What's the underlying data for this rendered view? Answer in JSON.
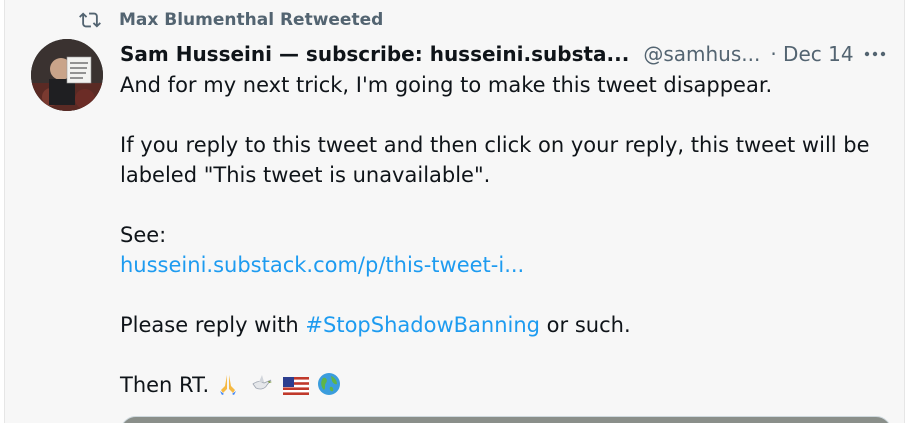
{
  "retweet": {
    "icon": "retweet-icon",
    "label": "Max Blumenthal Retweeted"
  },
  "author": {
    "name": "Sam Husseini — subscribe: husseini.substa...",
    "handle": "@samhus...",
    "date": "· Dec 14",
    "avatar_icon": "avatar"
  },
  "more_icon": "more-icon",
  "body": {
    "line1": "And for my next trick, I'm going to make this tweet disappear.",
    "para2": "If you reply to this tweet and then click on your reply, this tweet will be labeled \"This tweet is unavailable\".",
    "see_label": "See:",
    "link": "husseini.substack.com/p/this-tweet-i...",
    "reply_prefix": "Please reply with ",
    "hashtag": "#StopShadowBanning",
    "reply_suffix": " or such.",
    "final": "Then RT.",
    "emojis": [
      "folded-hands-emoji",
      "dove-emoji",
      "us-flag-emoji",
      "globe-emoji"
    ]
  },
  "colors": {
    "link": "#1d9bf0",
    "text": "#0f1419",
    "secondary": "#536471",
    "background": "#f7f7f7"
  }
}
